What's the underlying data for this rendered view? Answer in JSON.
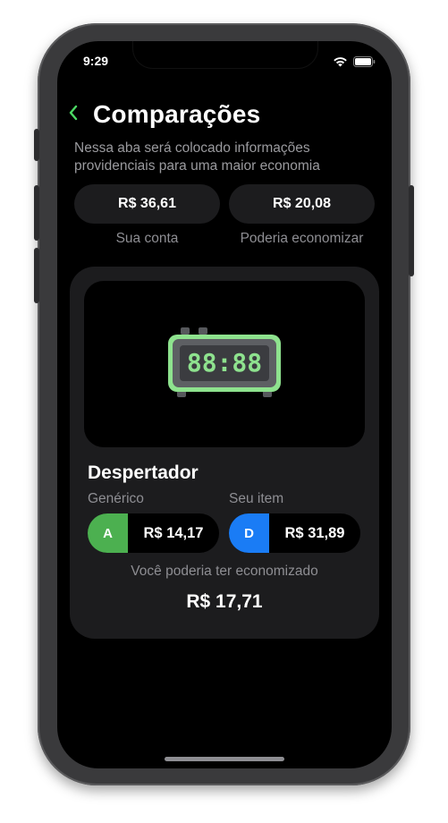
{
  "status": {
    "time": "9:29"
  },
  "header": {
    "back_icon": "chevron-left-icon",
    "title": "Comparações"
  },
  "subtitle": "Nessa aba será colocado informações providenciais para uma maior economia",
  "summary": {
    "account": {
      "value": "R$ 36,61",
      "caption": "Sua conta"
    },
    "savings": {
      "value": "R$ 20,08",
      "caption": "Poderia economizar"
    }
  },
  "item": {
    "image_icon": "digital-alarm-clock-icon",
    "clock_display": "88:88",
    "name": "Despertador",
    "generic": {
      "label": "Genérico",
      "grade": "A",
      "grade_color": "#4cb050",
      "price": "R$ 14,17"
    },
    "yours": {
      "label": "Seu item",
      "grade": "D",
      "grade_color": "#1a7cf5",
      "price": "R$ 31,89"
    },
    "savings_label": "Você poderia ter economizado",
    "savings_value": "R$ 17,71"
  },
  "colors": {
    "accent": "#4cd964",
    "card": "#1c1c1e",
    "background": "#000000"
  }
}
